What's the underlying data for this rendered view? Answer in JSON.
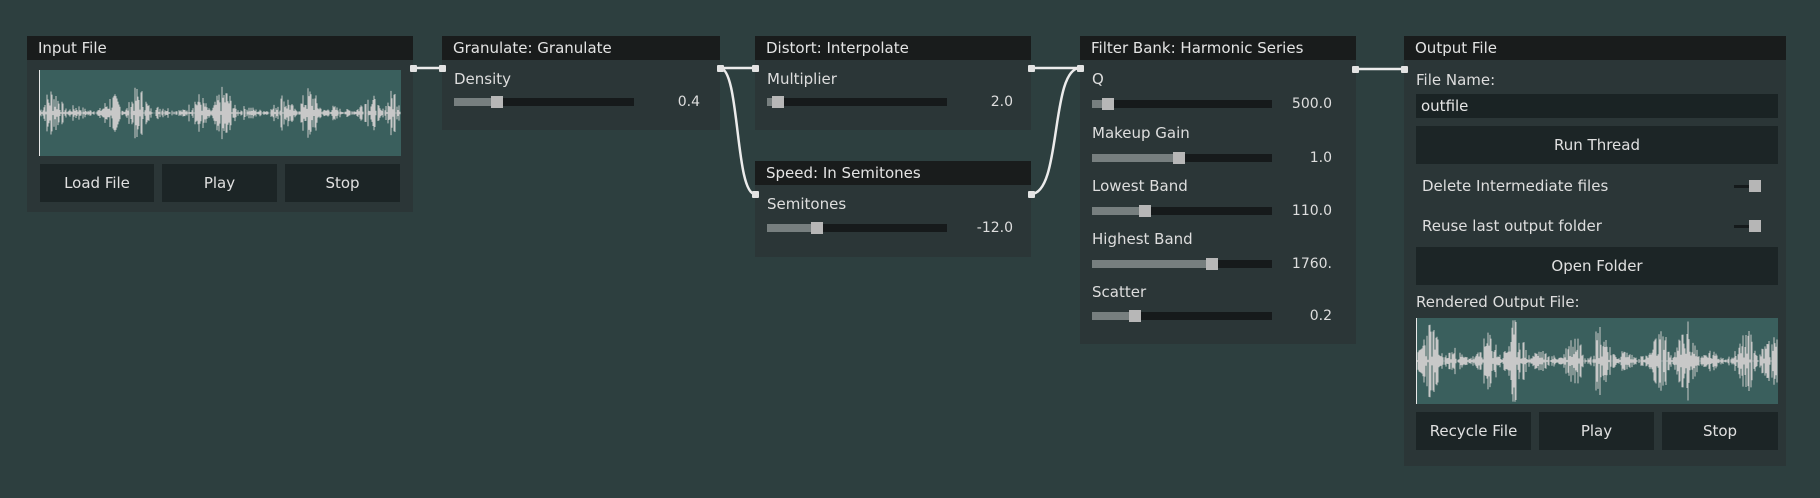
{
  "input_file": {
    "title": "Input File",
    "buttons": {
      "load": "Load File",
      "play": "Play",
      "stop": "Stop"
    }
  },
  "granulate": {
    "title": "Granulate: Granulate",
    "params": [
      {
        "label": "Density",
        "value": "0.4",
        "fraction": 0.22
      }
    ]
  },
  "distort": {
    "title": "Distort: Interpolate",
    "params": [
      {
        "label": "Multiplier",
        "value": "2.0",
        "fraction": 0.03
      }
    ]
  },
  "speed": {
    "title": "Speed: In Semitones",
    "params": [
      {
        "label": "Semitones",
        "value": "-12.0",
        "fraction": 0.26
      }
    ]
  },
  "filter_bank": {
    "title": "Filter Bank: Harmonic Series",
    "params": [
      {
        "label": "Q",
        "value": "500.0",
        "fraction": 0.06
      },
      {
        "label": "Makeup Gain",
        "value": "1.0",
        "fraction": 0.48
      },
      {
        "label": "Lowest Band",
        "value": "110.0",
        "fraction": 0.28
      },
      {
        "label": "Highest Band",
        "value": "1760.",
        "fraction": 0.68
      },
      {
        "label": "Scatter",
        "value": "0.2",
        "fraction": 0.22
      }
    ]
  },
  "output_file": {
    "title": "Output File",
    "file_name_label": "File Name:",
    "file_name_value": "outfile",
    "run_thread": "Run Thread",
    "delete_intermediate": "Delete Intermediate files",
    "reuse_folder": "Reuse last output folder",
    "open_folder": "Open Folder",
    "rendered_label": "Rendered Output File:",
    "buttons": {
      "recycle": "Recycle File",
      "play": "Play",
      "stop": "Stop"
    }
  },
  "colors": {
    "background": "#2d3f3f",
    "node_body": "#2b3637",
    "title_bar": "#191c1c",
    "waveform_bg": "#3a5f5d",
    "waveform": "#c8c8c8"
  }
}
